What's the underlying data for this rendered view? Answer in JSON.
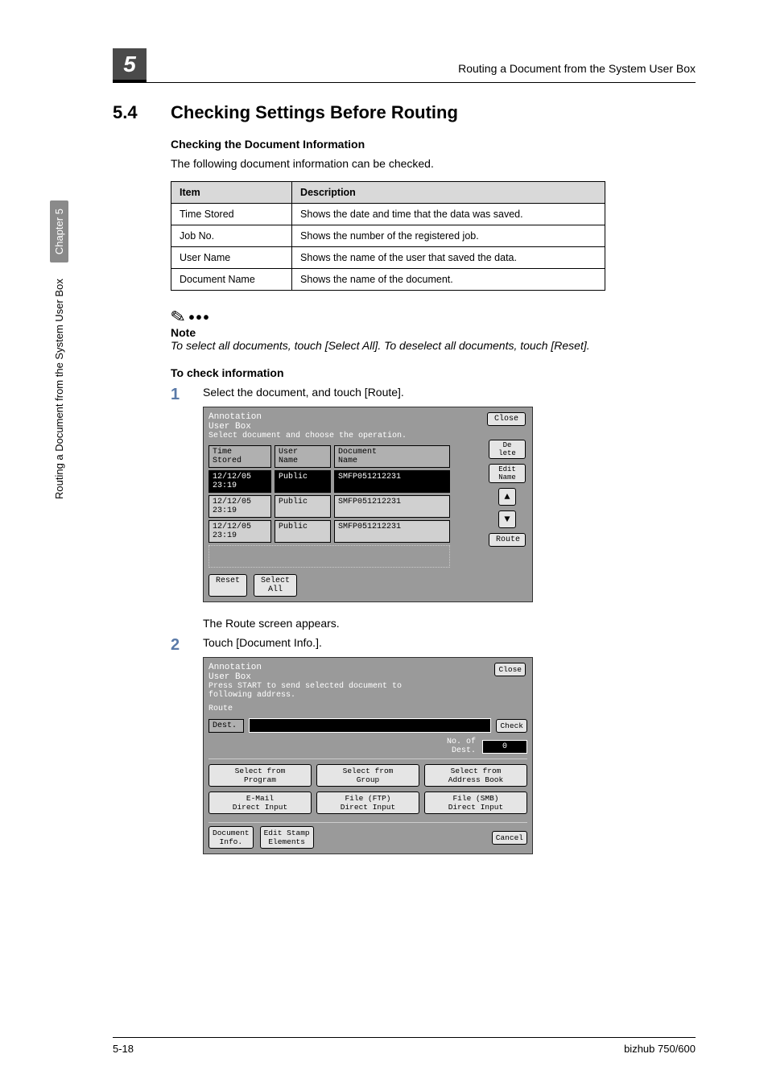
{
  "header": {
    "chapter_num": "5",
    "running_title": "Routing a Document from the System User Box"
  },
  "section": {
    "number": "5.4",
    "title": "Checking Settings Before Routing"
  },
  "sub1": {
    "heading": "Checking the Document Information",
    "intro": "The following document information can be checked."
  },
  "table": {
    "head_item": "Item",
    "head_desc": "Description",
    "rows": [
      {
        "item": "Time Stored",
        "desc": "Shows the date and time that the data was saved."
      },
      {
        "item": "Job No.",
        "desc": "Shows the number of the registered job."
      },
      {
        "item": "User Name",
        "desc": "Shows the name of the user that saved the data."
      },
      {
        "item": "Document Name",
        "desc": "Shows the name of the document."
      }
    ]
  },
  "note": {
    "label": "Note",
    "text": "To select all documents, touch [Select All]. To deselect all documents, touch [Reset]."
  },
  "sub2": {
    "heading": "To check information"
  },
  "steps": {
    "s1": {
      "num": "1",
      "text": "Select the document, and touch [Route].",
      "after": "The Route screen appears."
    },
    "s2": {
      "num": "2",
      "text": "Touch [Document Info.]."
    }
  },
  "screen1": {
    "title": "Annotation\nUser Box",
    "subtitle": "Select document and choose the operation.",
    "close": "Close",
    "cols": {
      "time": "Time\nStored",
      "user": "User\nName",
      "doc": "Document\nName"
    },
    "rows": [
      {
        "time": "12/12/05\n23:19",
        "user": "Public",
        "doc": "SMFP051212231"
      },
      {
        "time": "12/12/05\n23:19",
        "user": "Public",
        "doc": "SMFP051212231"
      },
      {
        "time": "12/12/05\n23:19",
        "user": "Public",
        "doc": "SMFP051212231"
      }
    ],
    "btn_delete": "De\nlete",
    "btn_edit": "Edit\nName",
    "btn_route": "Route",
    "btn_reset": "Reset",
    "btn_selectall": "Select\nAll"
  },
  "screen2": {
    "title": "Annotation\nUser Box",
    "subtitle": "Press START to send selected document to\nfollowing address.",
    "close": "Close",
    "route_label": "Route",
    "dest_label": "Dest.",
    "check": "Check",
    "no_of_dest_label": "No. of\nDest.",
    "no_of_dest_val": "0",
    "btns_row1": [
      "Select from\nProgram",
      "Select from\nGroup",
      "Select from\nAddress Book"
    ],
    "btns_row2": [
      "E-Mail\nDirect Input",
      "File (FTP)\nDirect Input",
      "File (SMB)\nDirect Input"
    ],
    "btn_docinfo": "Document\nInfo.",
    "btn_editstamp": "Edit Stamp\nElements",
    "btn_cancel": "Cancel"
  },
  "side": {
    "long": "Routing a Document from the System User Box",
    "chapter": "Chapter 5"
  },
  "footer": {
    "page": "5-18",
    "model": "bizhub 750/600"
  }
}
